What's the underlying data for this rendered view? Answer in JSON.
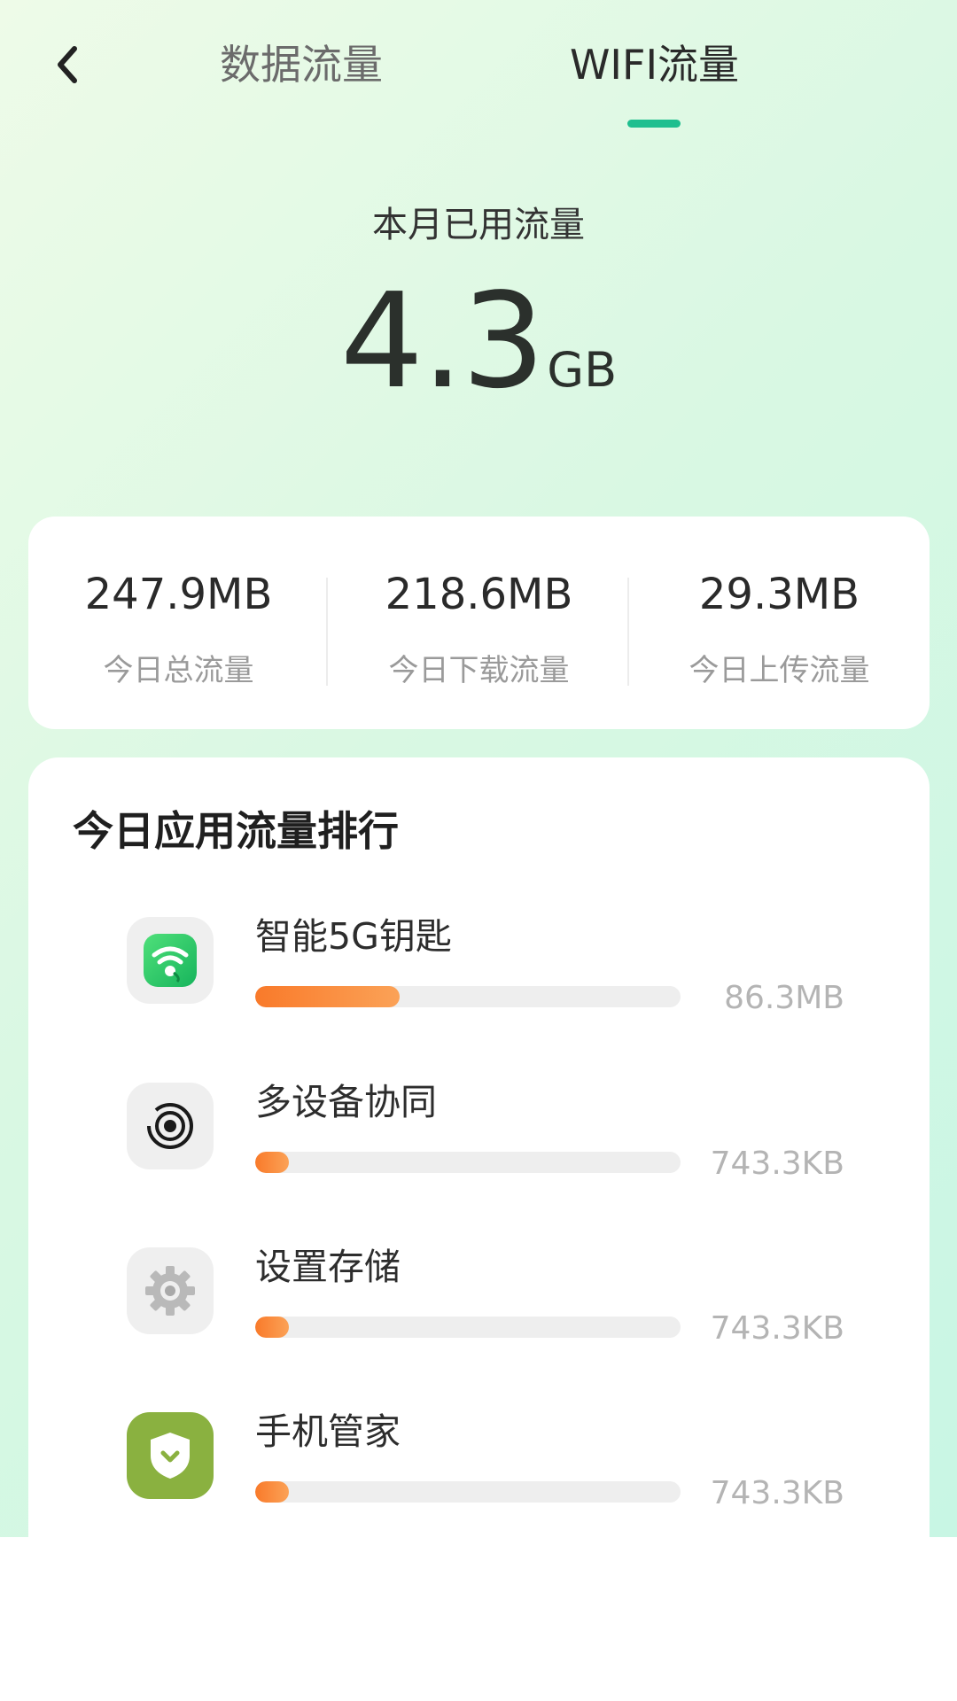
{
  "header": {
    "tabs": [
      {
        "label": "数据流量",
        "active": false
      },
      {
        "label": "WIFI流量",
        "active": true
      }
    ]
  },
  "usage": {
    "title": "本月已用流量",
    "value": "4.3",
    "unit": "GB"
  },
  "stats": [
    {
      "value": "247.9MB",
      "label": "今日总流量"
    },
    {
      "value": "218.6MB",
      "label": "今日下载流量"
    },
    {
      "value": "29.3MB",
      "label": "今日上传流量"
    }
  ],
  "ranking": {
    "title": "今日应用流量排行",
    "apps": [
      {
        "name": "智能5G钥匙",
        "size": "86.3MB",
        "fraction": 0.34,
        "icon": "wifi-key-icon"
      },
      {
        "name": "多设备协同",
        "size": "743.3KB",
        "fraction": 0.08,
        "icon": "device-sync-icon"
      },
      {
        "name": "设置存储",
        "size": "743.3KB",
        "fraction": 0.08,
        "icon": "gear-icon"
      },
      {
        "name": "手机管家",
        "size": "743.3KB",
        "fraction": 0.08,
        "icon": "shield-icon"
      }
    ]
  },
  "colors": {
    "accent": "#1fbf8f",
    "bar": "#f97a2a",
    "track": "#eeeeee"
  }
}
